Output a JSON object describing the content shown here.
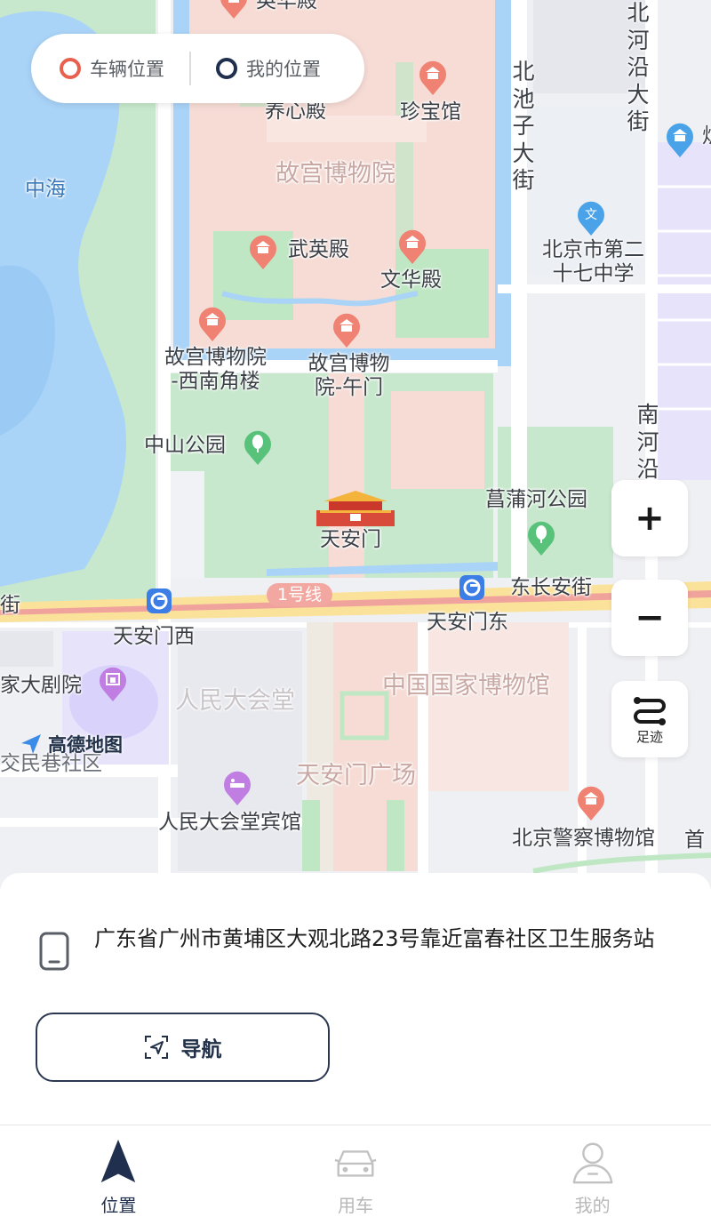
{
  "legend": {
    "vehicle_label": "车辆位置",
    "mine_label": "我的位置",
    "vehicle_color": "#e8614e",
    "mine_color": "#1f2f4d"
  },
  "map": {
    "labels": {
      "qianqing": "英华殿",
      "yangxin": "养心殿",
      "zhenbao": "珍宝馆",
      "gugong": "故宫博物院",
      "wuying": "武英殿",
      "wenhua": "文华殿",
      "southwest_corner": "故宫博物院\n-西南角楼",
      "wumen": "故宫博物\n院-午门",
      "zhongshan": "中山公园",
      "tiananmen": "天安门",
      "changpu": "菖蒲河公园",
      "zhonghai": "中海",
      "beichizi": "北池子大街",
      "beiheyan": "北河沿大街",
      "nanheyan": "南河沿",
      "school": "北京市第二\n十七中学",
      "line1": "1号线",
      "dongchangan": "东长安街",
      "jie": "街",
      "tiananmen_west": "天安门西",
      "tiananmen_east": "天安门东",
      "theater": "家大剧院",
      "great_hall": "人民大会堂",
      "museum": "中国国家博物馆",
      "square": "天安门广场",
      "jiaomin": "交民巷社区",
      "great_hall_hotel": "人民大会堂宾馆",
      "police_museum": "北京警察博物馆",
      "shou": "首",
      "edge_right": "炉"
    },
    "brand": "高德地图",
    "colors": {
      "palace": "#f6dcd5",
      "moat": "#a9d3f7",
      "park": "#bfe7c4",
      "water": "#a9d3f7",
      "road_yellow": "#fbe29a",
      "road_red": "#f0a39c",
      "block_purple": "#e7e3fb"
    }
  },
  "controls": {
    "zoom_in": "+",
    "zoom_out": "−",
    "track_label": "足迹"
  },
  "sheet": {
    "address": "广东省广州市黄埔区大观北路23号靠近富春社区卫生服务站",
    "nav_label": "导航"
  },
  "tabs": [
    {
      "label": "位置",
      "active": true
    },
    {
      "label": "用车",
      "active": false
    },
    {
      "label": "我的",
      "active": false
    }
  ]
}
